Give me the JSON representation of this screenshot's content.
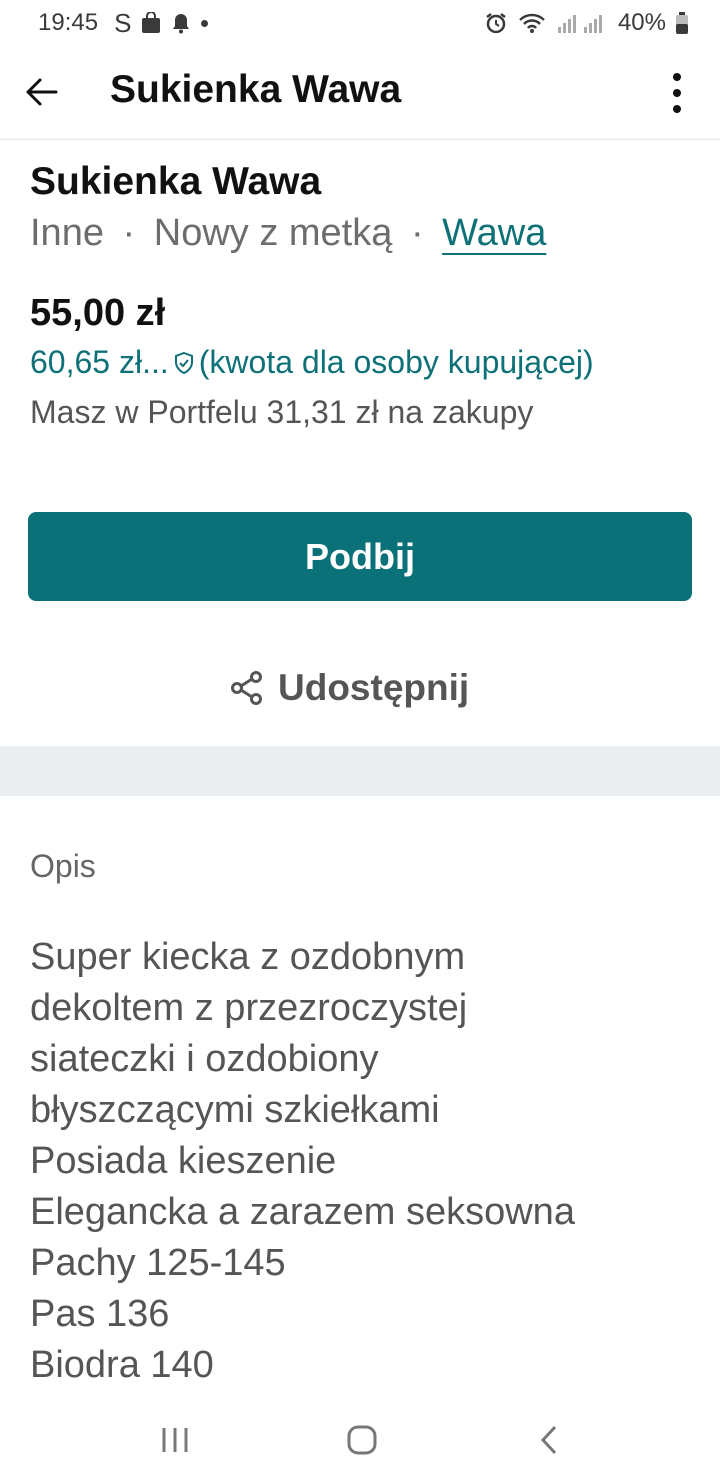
{
  "status_bar": {
    "time": "19:45",
    "app_letter": "S",
    "battery": "40%",
    "icons": [
      "shopping-bag-icon",
      "notification-bell-icon",
      "alarm-icon",
      "wifi-icon",
      "signal-icon",
      "battery-icon"
    ]
  },
  "app_bar": {
    "title": "Sukienka Wawa",
    "icons": [
      "back-arrow-icon",
      "more-vert-icon"
    ]
  },
  "item": {
    "title": "Sukienka Wawa",
    "category": "Inne",
    "condition": "Nowy z metką",
    "separator": "·",
    "location": "Wawa",
    "price": "55,00 zł",
    "buyer_price": "60,65 zł...",
    "buyer_price_note": "(kwota dla osoby kupującej)",
    "wallet_text": "Masz w Portfelu 31,31 zł na zakupy"
  },
  "actions": {
    "bump_label": "Podbij",
    "share_label": "Udostępnij"
  },
  "description": {
    "label": "Opis",
    "lines": [
      "Super kiecka z ozdobnym",
      "dekoltem z przezroczystej",
      "siateczki i ozdobiony",
      "błyszczącymi szkiełkami",
      "Posiada kieszenie",
      "Elegancka a zarazem seksowna",
      "Pachy 125-145",
      "Pas 136",
      "Biodra 140"
    ]
  },
  "colors": {
    "accent": "#0a7179",
    "divider": "#eaeef0"
  }
}
